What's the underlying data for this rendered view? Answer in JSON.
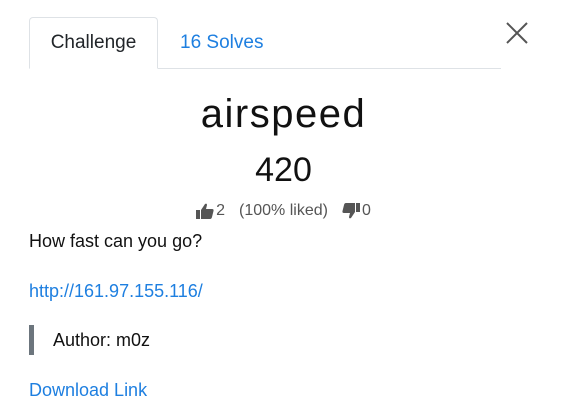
{
  "tabs": [
    {
      "label": "Challenge",
      "active": true
    },
    {
      "label": "16 Solves",
      "active": false
    }
  ],
  "challenge": {
    "name": "airspeed",
    "points": "420",
    "likes": "2",
    "liked_pct": "(100% liked)",
    "dislikes": "0",
    "description": "How fast can you go?",
    "url": "http://161.97.155.116/",
    "author": "Author: m0z",
    "download_label": "Download Link"
  },
  "colors": {
    "link": "#1e7fe0",
    "text": "#111111",
    "border": "#dee2e6",
    "quote_bar": "#6c757d"
  },
  "icons": {
    "close": "close-icon",
    "like": "thumbs-up-icon",
    "dislike": "thumbs-down-icon"
  }
}
